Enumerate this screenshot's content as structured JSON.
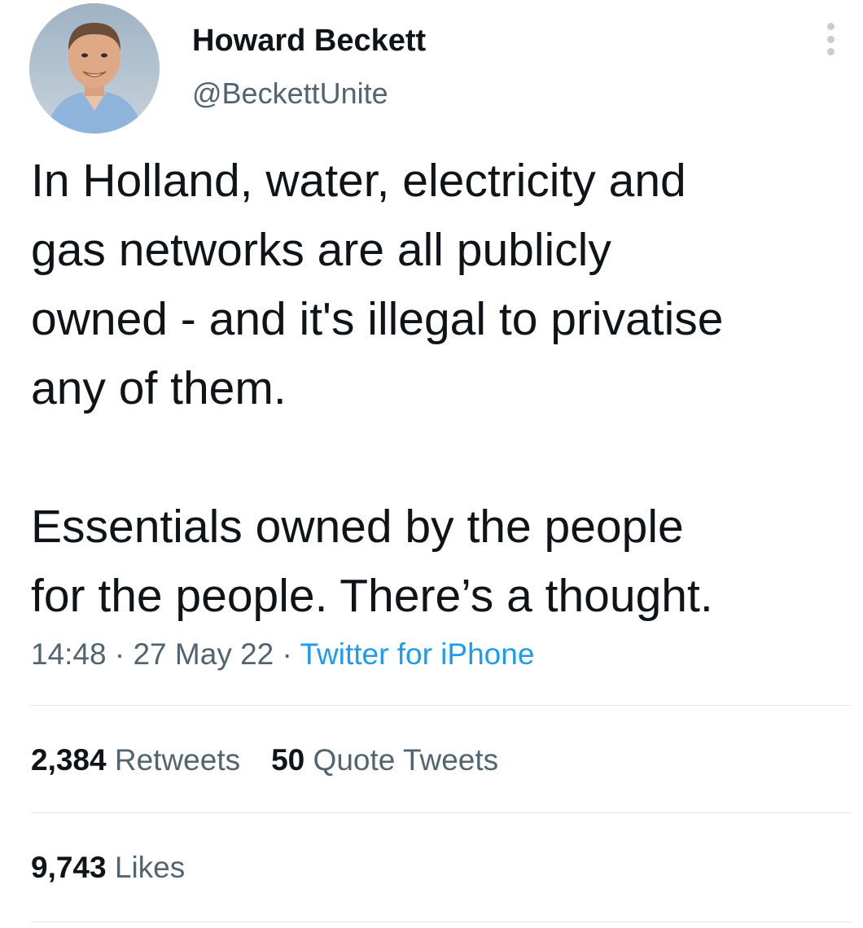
{
  "author": {
    "name": "Howard Beckett",
    "handle": "@BeckettUnite",
    "avatar_icon": "profile-photo"
  },
  "more_icon": "more-vertical-icon",
  "tweet": {
    "lines_p1": [
      "In Holland, water, electricity and",
      "gas networks are all publicly",
      "owned - and it's illegal to privatise",
      "any of them."
    ],
    "lines_p2": [
      "Essentials owned by the people",
      "for the people. There’s a thought."
    ]
  },
  "meta": {
    "time": "14:48",
    "separator_1": " · ",
    "date": "27 May 22",
    "separator_2": " · ",
    "source": "Twitter for iPhone"
  },
  "stats": {
    "retweets_count": "2,384",
    "retweets_label": "Retweets",
    "quotes_count": "50",
    "quotes_label": "Quote Tweets",
    "likes_count": "9,743",
    "likes_label": "Likes"
  },
  "colors": {
    "text": "#0f1419",
    "secondary": "#536471",
    "link": "#1d9bf0",
    "divider": "#dfe5e9"
  }
}
